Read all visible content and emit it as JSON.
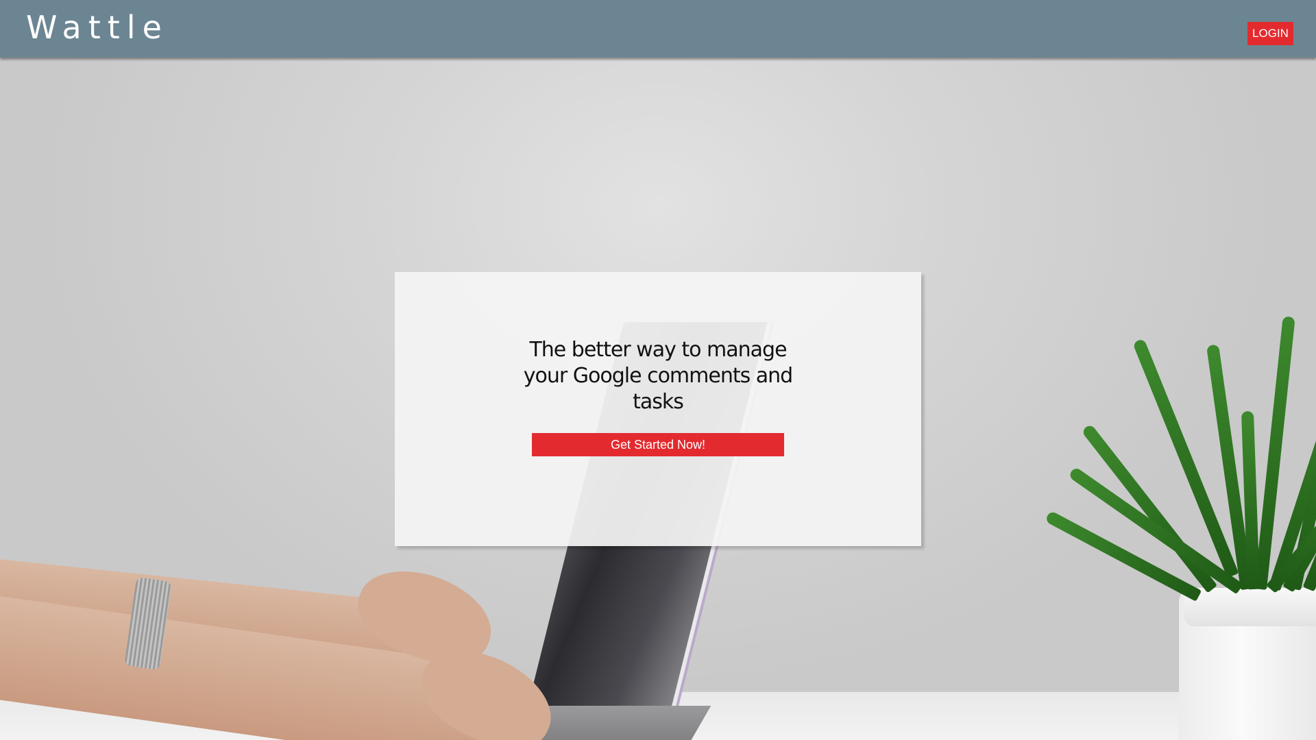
{
  "header": {
    "brand": "Wattle",
    "login_label": "LOGIN"
  },
  "hero": {
    "headline": "The better way to manage your Google comments and tasks",
    "cta_label": "Get Started Now!"
  },
  "colors": {
    "header_bg": "#6c8592",
    "accent_red": "#e32b2f"
  },
  "background": {
    "subject": "laptop-on-desk-with-potted-plant"
  }
}
